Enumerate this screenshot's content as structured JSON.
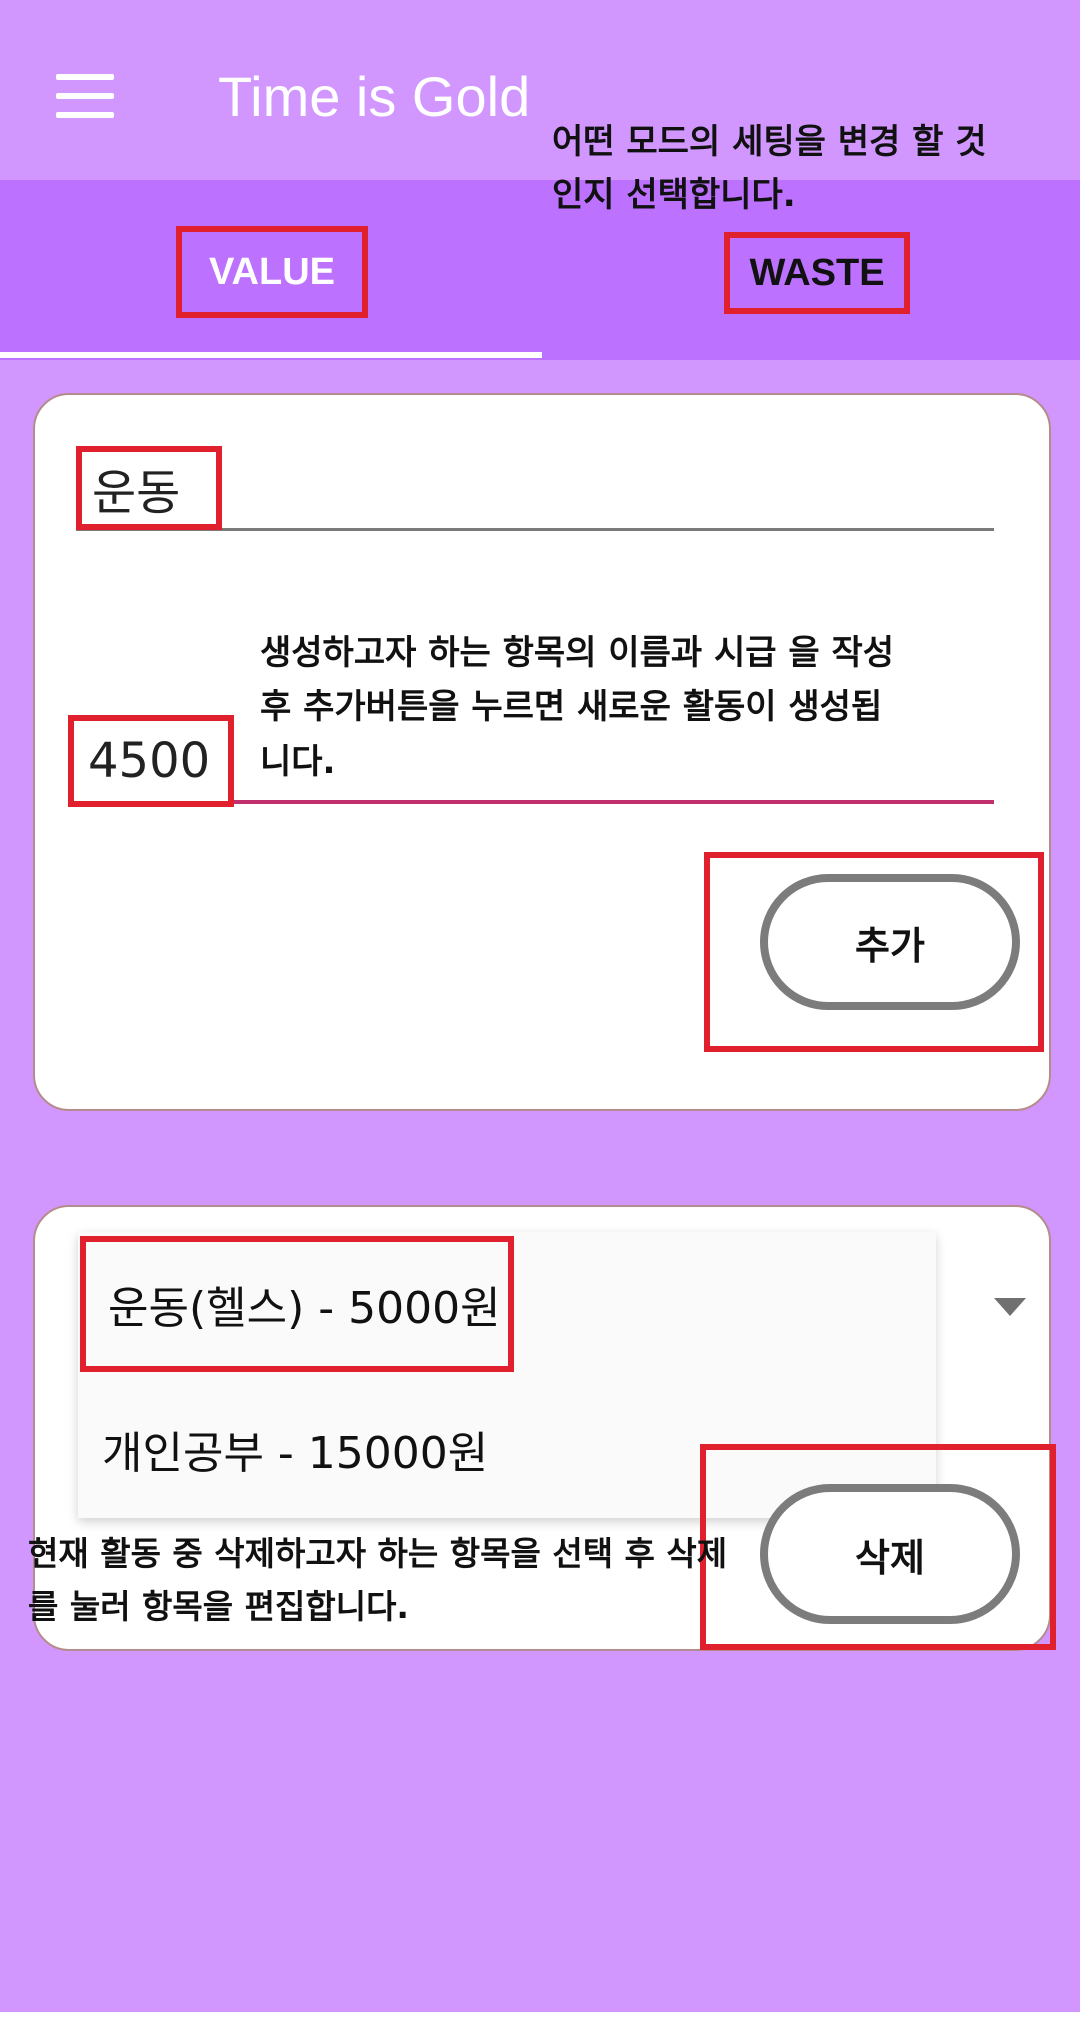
{
  "app": {
    "title": "Time is Gold"
  },
  "icons": {
    "menu": "hamburger-menu-icon",
    "dropdown": "dropdown-arrow-icon"
  },
  "tabs": {
    "items": [
      {
        "label": "VALUE",
        "selected": true
      },
      {
        "label": "WASTE",
        "selected": false
      }
    ]
  },
  "annotations": {
    "tabs": "어떤 모드의 세팅을 변경 할 것인지 선택합니다.",
    "create": "생성하고자 하는 항목의 이름과 시급 을 작성후 추가버튼을 누르면 새로운 활동이 생성됩니다.",
    "delete": "현재 활동 중 삭제하고자 하는 항목을 선택 후 삭제를 눌러 항목을 편집합니다."
  },
  "create_form": {
    "name_value": "운동",
    "wage_value": "4500",
    "add_label": "추가"
  },
  "delete_form": {
    "options": [
      {
        "label": "운동(헬스) - 5000원",
        "selected": true
      },
      {
        "label": "개인공부 - 15000원",
        "selected": false
      }
    ],
    "delete_label": "삭제"
  },
  "colors": {
    "background": "#d197ff",
    "tab_bar": "#bd72ff",
    "highlight": "#e0202c",
    "card": "#ffffff",
    "button_border": "#7c7c7c"
  }
}
